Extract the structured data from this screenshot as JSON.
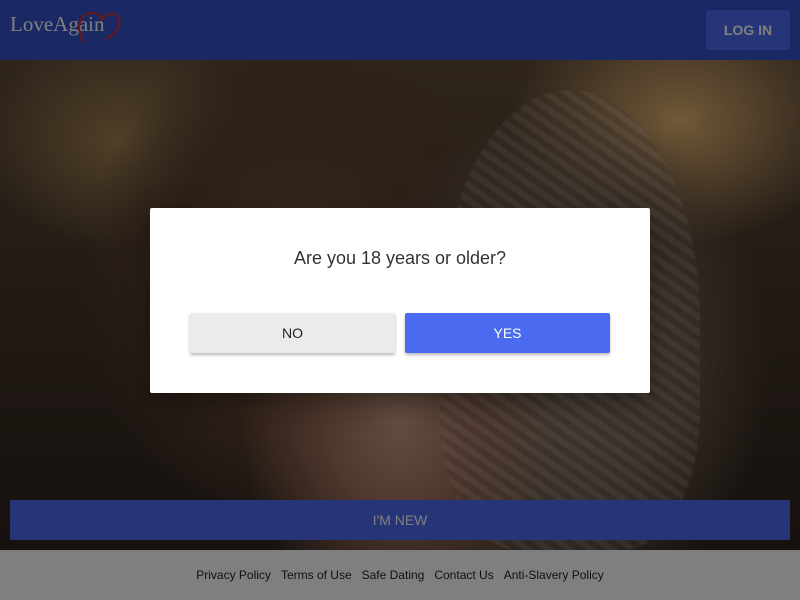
{
  "header": {
    "logo_text": "LoveAgain",
    "login_label": "LOG IN"
  },
  "hero": {
    "new_user_label": "I'M NEW"
  },
  "footer": {
    "links": [
      "Privacy Policy",
      "Terms of Use",
      "Safe Dating",
      "Contact Us",
      "Anti-Slavery Policy"
    ]
  },
  "dialog": {
    "question": "Are you 18 years or older?",
    "no_label": "NO",
    "yes_label": "YES"
  },
  "colors": {
    "brand_blue": "#4a6bf0",
    "logo_heart": "#d32f2f"
  },
  "icons": {
    "logo": "heart-icon"
  }
}
